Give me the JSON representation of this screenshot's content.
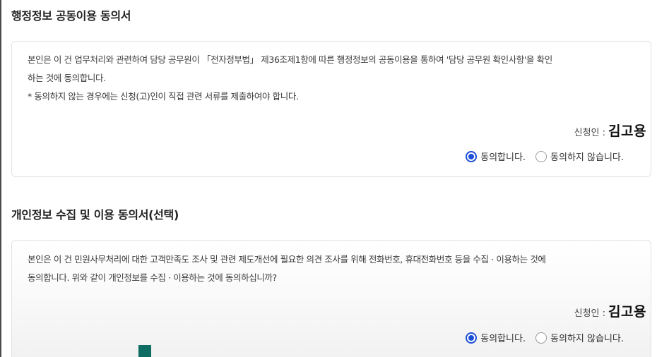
{
  "section1": {
    "title": "행정정보 공동이용 동의서",
    "text_line1": "본인은 이 건 업무처리와 관련하여 담당 공무원이 「전자정부법」 제36조제1항에 따른 행정정보의 공동이용을 통하여 '담당 공무원 확인사항'을 확인",
    "text_line2": "하는 것에 동의합니다.",
    "text_line3": "* 동의하지 않는 경우에는 신청(고)인이 직접 관련 서류를 제출하여야 합니다.",
    "signer_label": "신청인 :",
    "signer_name": "김고용",
    "option_agree": "동의합니다.",
    "option_disagree": "동의하지 않습니다.",
    "selected": "agree"
  },
  "section2": {
    "title": "개인정보 수집 및 이용 동의서(선택)",
    "text_line1": "본인은 이 건 민원사무처리에 대한 고객만족도 조사 및 관련 제도개선에 필요한 의견 조사를 위해 전화번호, 휴대전화번호 등을 수집 · 이용하는 것에",
    "text_line2": "동의합니다. 위와 같이 개인정보를 수집 · 이용하는 것에 동의하십니까?",
    "signer_label": "신청인 :",
    "signer_name": "김고용",
    "option_agree": "동의합니다.",
    "option_disagree": "동의하지 않습니다.",
    "selected": "agree"
  },
  "colors": {
    "radio_selected": "#1d4fd8",
    "overlay_block": "#0f6c63"
  }
}
